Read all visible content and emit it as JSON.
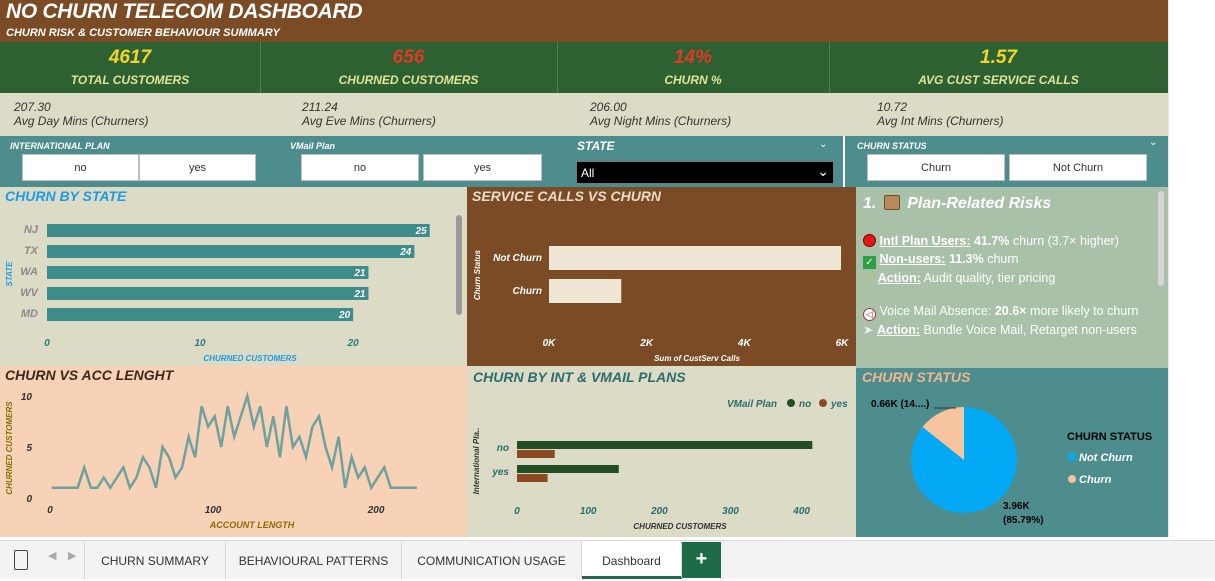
{
  "header": {
    "title": "NO CHURN TELECOM DASHBOARD",
    "subtitle": "CHURN RISK & CUSTOMER BEHAVIOUR SUMMARY"
  },
  "kpis": [
    {
      "value": "4617",
      "label": "TOTAL CUSTOMERS",
      "color": "#f2d52b"
    },
    {
      "value": "656",
      "label": "CHURNED CUSTOMERS",
      "color": "#e23a22"
    },
    {
      "value": "14%",
      "label": "CHURN %",
      "color": "#e23a22"
    },
    {
      "value": "1.57",
      "label": "AVG CUST SERVICE CALLS",
      "color": "#f2d52b"
    }
  ],
  "averages": [
    {
      "value": "207.30",
      "label": "Avg Day Mins (Churners)"
    },
    {
      "value": "211.24",
      "label": "Avg Eve Mins (Churners)"
    },
    {
      "value": "206.00",
      "label": "Avg Night Mins (Churners)"
    },
    {
      "value": "10.72",
      "label": "Avg Int Mins (Churners)"
    }
  ],
  "filters": {
    "intl": {
      "label": "INTERNATIONAL PLAN",
      "options": [
        "no",
        "yes"
      ]
    },
    "vmail": {
      "label": "VMail Plan",
      "options": [
        "no",
        "yes"
      ]
    },
    "state": {
      "label": "STATE",
      "value": "All"
    },
    "churn": {
      "label": "CHURN STATUS",
      "options": [
        "Churn",
        "Not Churn"
      ]
    }
  },
  "state_chart": {
    "title": "CHURN BY STATE",
    "chart_data": {
      "type": "bar",
      "orientation": "horizontal",
      "categories": [
        "NJ",
        "TX",
        "WA",
        "WV",
        "MD"
      ],
      "values": [
        25,
        24,
        21,
        21,
        20
      ],
      "xlabel": "CHURNED CUSTOMERS",
      "ylabel": "STATE",
      "xlim": [
        0,
        26
      ],
      "xticks": [
        "0",
        "10",
        "20"
      ]
    }
  },
  "service_chart": {
    "title": "SERVICE CALLS VS CHURN",
    "chart_data": {
      "type": "bar",
      "orientation": "horizontal",
      "categories": [
        "Not Churn",
        "Churn"
      ],
      "values": [
        5980,
        1480
      ],
      "xlabel": "Sum of CustServ Calls",
      "ylabel": "Churn Status",
      "xlim": [
        0,
        6000
      ],
      "xticks": [
        "0K",
        "2K",
        "4K",
        "6K"
      ]
    }
  },
  "risks": {
    "heading": "1.",
    "heading_text": "Plan-Related Risks",
    "line1_label": "Intl Plan Users:",
    "line1_value": "41.7%",
    "line1_rest": "churn (3.7× higher)",
    "line2_label": "Non-users:",
    "line2_value": "11.3%",
    "line2_rest": "churn",
    "line3_label": "Action:",
    "line3_rest": "Audit quality, tier pricing",
    "line4_pre": "Voice Mail Absence:",
    "line4_value": "20.6×",
    "line4_rest": "more likely to churn",
    "line5_label": "Action:",
    "line5_rest": "Bundle Voice Mail, Retarget non-users"
  },
  "acc_chart": {
    "title": "CHURN VS ACC LENGHT",
    "chart_data": {
      "type": "line",
      "xlabel": "ACCOUNT LENGTH",
      "ylabel": "CHURNED CUSTOMERS",
      "xlim": [
        0,
        230
      ],
      "ylim": [
        0,
        10
      ],
      "xticks": [
        "0",
        "100",
        "200"
      ],
      "yticks": [
        "0",
        "5",
        "10"
      ],
      "x": [
        1,
        5,
        9,
        13,
        17,
        21,
        25,
        29,
        33,
        37,
        41,
        45,
        49,
        53,
        57,
        61,
        65,
        69,
        73,
        77,
        81,
        85,
        89,
        93,
        97,
        101,
        105,
        109,
        113,
        117,
        121,
        125,
        129,
        133,
        137,
        141,
        145,
        149,
        153,
        157,
        161,
        165,
        169,
        173,
        177,
        181,
        185,
        189,
        193,
        197,
        201,
        205,
        209,
        213,
        217,
        221,
        225
      ],
      "y": [
        1,
        1,
        1,
        1,
        1,
        3,
        1,
        1,
        2,
        1,
        2,
        3,
        1,
        2,
        4,
        3,
        1,
        5,
        4,
        2,
        3,
        6,
        4,
        9,
        7,
        8,
        5,
        9,
        6,
        8,
        10,
        7,
        9,
        5,
        8,
        4,
        9,
        5,
        6,
        4,
        7,
        8,
        5,
        3,
        6,
        1,
        4,
        2,
        3,
        1,
        2,
        3,
        1,
        1,
        1,
        1,
        1
      ]
    }
  },
  "plans_chart": {
    "title": "CHURN BY INT & VMAIL PLANS",
    "chart_data": {
      "type": "bar",
      "orientation": "horizontal",
      "categories": [
        "no",
        "yes"
      ],
      "series": [
        {
          "name": "no",
          "values": [
            415,
            143
          ]
        },
        {
          "name": "yes",
          "values": [
            53,
            43
          ]
        }
      ],
      "xlabel": "CHURNED CUSTOMERS",
      "ylabel": "International Pla..",
      "legend_title": "VMail Plan",
      "xlim": [
        0,
        430
      ],
      "xticks": [
        "0",
        "100",
        "200",
        "300",
        "400"
      ]
    }
  },
  "status_chart": {
    "title": "CHURN STATUS",
    "chart_data": {
      "type": "pie",
      "labels": [
        "Not Churn",
        "Churn"
      ],
      "values": [
        3960,
        660
      ],
      "percent": [
        85.79,
        14.21
      ],
      "legend_title": "CHURN STATUS",
      "label_churn": "0.66K (14....)",
      "label_notchurn_value": "3.96K",
      "label_notchurn_pct": "(85.79%)"
    }
  },
  "tabs": [
    "CHURN SUMMARY",
    "BEHAVIOURAL PATTERNS",
    "COMMUNICATION USAGE",
    "Dashboard"
  ],
  "colors": {
    "teal": "#4d8d8d",
    "brown": "#7a4b24",
    "green": "#2e6132",
    "pie_blue": "#03a9f4",
    "pie_peach": "#f7c4a0",
    "bar_teal": "#3f8c8c",
    "bar_cream": "#f0e6d6",
    "bar_darkgreen": "#234d23",
    "bar_brown": "#8b4a22"
  }
}
